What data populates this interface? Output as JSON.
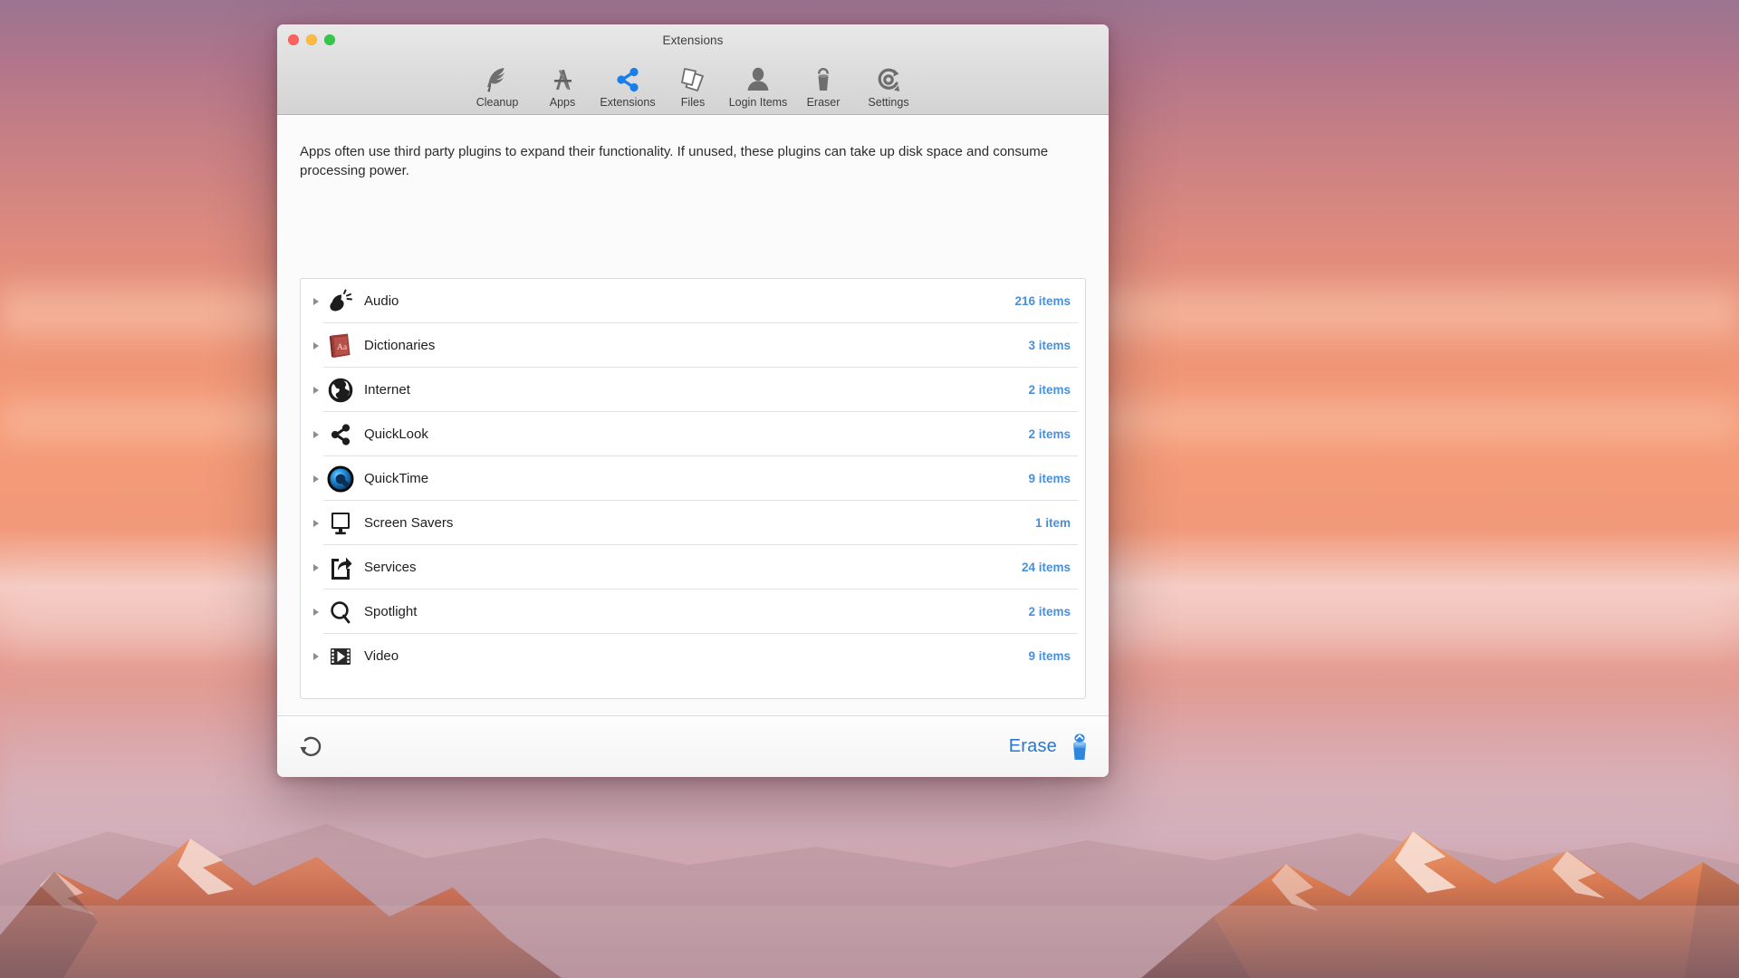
{
  "window": {
    "title": "Extensions",
    "traffic_lights": [
      {
        "name": "close",
        "color": "#fc615d"
      },
      {
        "name": "minimize",
        "color": "#fdbc40"
      },
      {
        "name": "zoom",
        "color": "#34c749"
      }
    ]
  },
  "toolbar": {
    "active": "Extensions",
    "items": [
      {
        "label": "Cleanup",
        "icon": "feather-icon",
        "active": false
      },
      {
        "label": "Apps",
        "icon": "app-store-icon",
        "active": false
      },
      {
        "label": "Extensions",
        "icon": "share-node-icon",
        "active": true
      },
      {
        "label": "Files",
        "icon": "documents-icon",
        "active": false
      },
      {
        "label": "Login Items",
        "icon": "person-icon",
        "active": false
      },
      {
        "label": "Eraser",
        "icon": "trash-can-icon",
        "active": false
      },
      {
        "label": "Settings",
        "icon": "gear-loop-icon",
        "active": false
      }
    ]
  },
  "main": {
    "description": "Apps often use third party plugins to expand their functionality. If unused, these plugins can take up disk space and consume processing power.",
    "rows": [
      {
        "label": "Audio",
        "count": "216 items",
        "icon": "audio-plugin-icon"
      },
      {
        "label": "Dictionaries",
        "count": "3 items",
        "icon": "dictionary-book-icon"
      },
      {
        "label": "Internet",
        "count": "2 items",
        "icon": "globe-icon"
      },
      {
        "label": "QuickLook",
        "count": "2 items",
        "icon": "share-node-icon"
      },
      {
        "label": "QuickTime",
        "count": "9 items",
        "icon": "quicktime-icon"
      },
      {
        "label": "Screen Savers",
        "count": "1 item",
        "icon": "display-icon"
      },
      {
        "label": "Services",
        "count": "24 items",
        "icon": "share-arrow-box-icon"
      },
      {
        "label": "Spotlight",
        "count": "2 items",
        "icon": "magnifier-icon"
      },
      {
        "label": "Video",
        "count": "9 items",
        "icon": "film-play-icon"
      }
    ]
  },
  "footer": {
    "refresh_icon": "refresh-circular-arrow-icon",
    "erase_label": "Erase",
    "erase_icon": "blue-trash-can-icon"
  },
  "colors": {
    "accent_blue": "#4a90d9",
    "erase_blue": "#2a76d2",
    "toolbar_active_blue": "#1a7ee8",
    "label_dark": "#1d1d1d"
  }
}
